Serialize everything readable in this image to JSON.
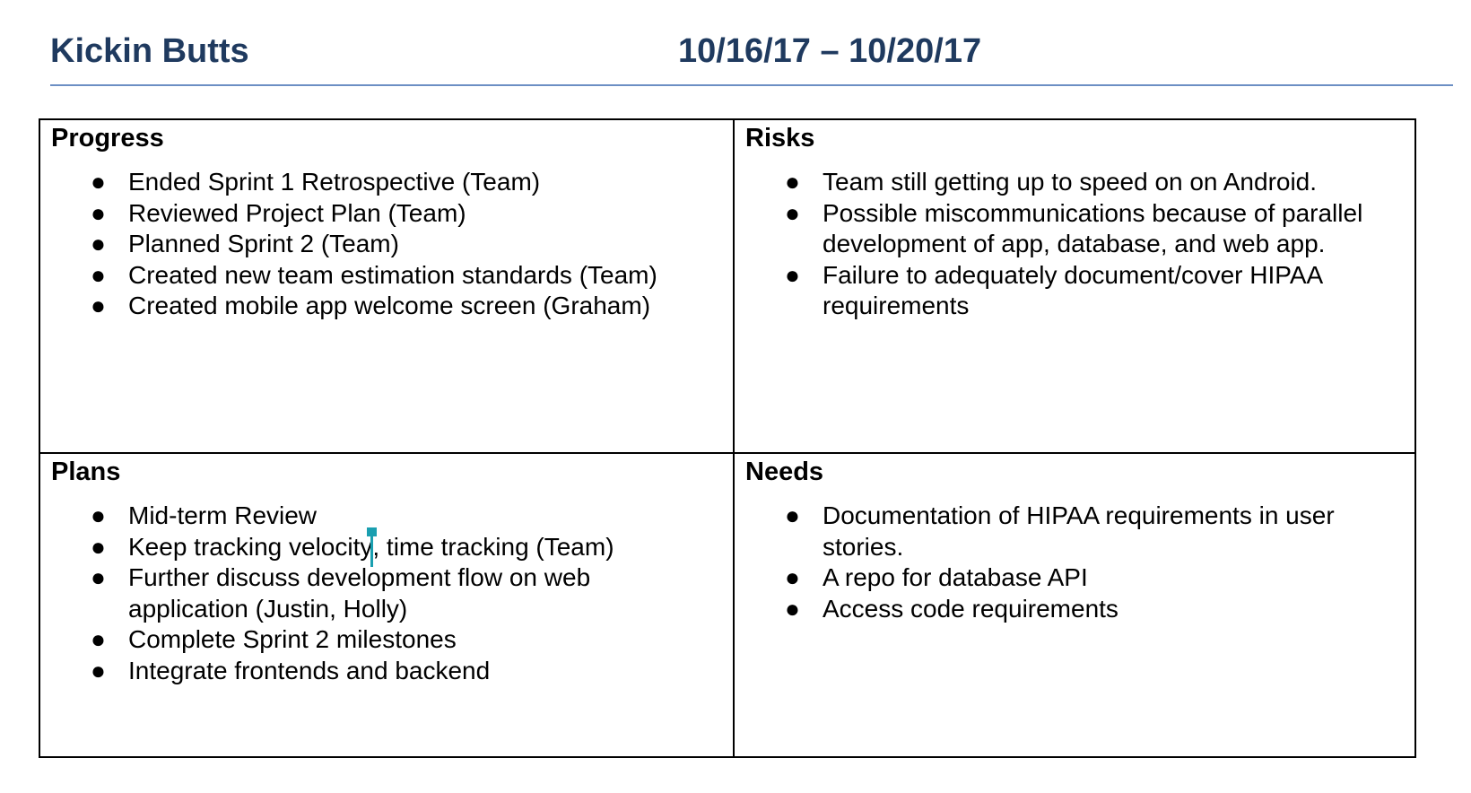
{
  "header": {
    "team_name": "Kickin Butts",
    "date_range": "10/16/17 – 10/20/17"
  },
  "progress": {
    "title": "Progress",
    "items": [
      "Ended Sprint 1 Retrospective (Team)",
      "Reviewed Project Plan (Team)",
      "Planned Sprint 2 (Team)",
      "Created new team estimation standards (Team)",
      "Created mobile app welcome screen (Graham)"
    ]
  },
  "risks": {
    "title": "Risks",
    "items": [
      "Team still getting up to speed on on Android.",
      "Possible miscommunications because of parallel development of app, database, and web app.",
      "Failure to adequately document/cover HIPAA requirements"
    ]
  },
  "plans": {
    "title": "Plans",
    "items": [
      "Mid-term Review",
      "Further discuss development flow on web application (Justin, Holly)",
      "Complete Sprint 2 milestones",
      "Integrate frontends and backend"
    ],
    "cursor_item": {
      "before": "Keep tracking velocity",
      "after": ", time tracking (Team)"
    }
  },
  "needs": {
    "title": "Needs",
    "items": [
      "Documentation of HIPAA requirements in user stories.",
      "A repo for database API",
      "Access code requirements"
    ]
  },
  "bullet_glyph": "●",
  "colors": {
    "heading": "#1f3a5f",
    "rule": "#6c8fc4",
    "cursor": "#1a9fb0"
  }
}
